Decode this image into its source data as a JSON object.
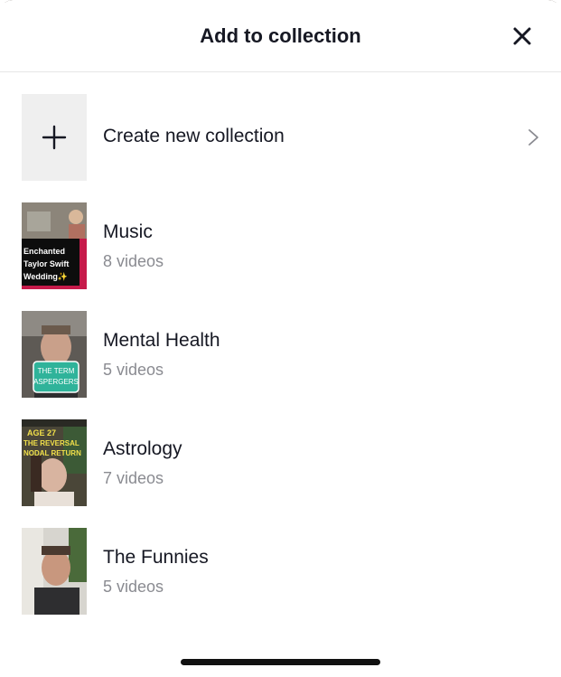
{
  "header": {
    "title": "Add to collection",
    "close_icon": "close-icon"
  },
  "create": {
    "label": "Create new collection",
    "icon": "plus-icon",
    "chevron_icon": "chevron-right-icon"
  },
  "collections": [
    {
      "name": "Music",
      "count": "8 videos",
      "thumb_text": [
        "Enchanted",
        "Taylor Swift",
        "Wedding✨"
      ]
    },
    {
      "name": "Mental Health",
      "count": "5 videos",
      "thumb_text": [
        "THE TERM",
        "ASPERGERS"
      ]
    },
    {
      "name": "Astrology",
      "count": "7 videos",
      "thumb_text": [
        "AGE 27",
        "THE REVERSAL",
        "NODAL RETURN"
      ]
    },
    {
      "name": "The Funnies",
      "count": "5 videos",
      "thumb_text": []
    }
  ],
  "colors": {
    "text_primary": "#161823",
    "text_secondary": "#8a8b91",
    "divider": "#e6e6e6",
    "create_tile": "#efefef",
    "home_indicator": "#111111"
  }
}
